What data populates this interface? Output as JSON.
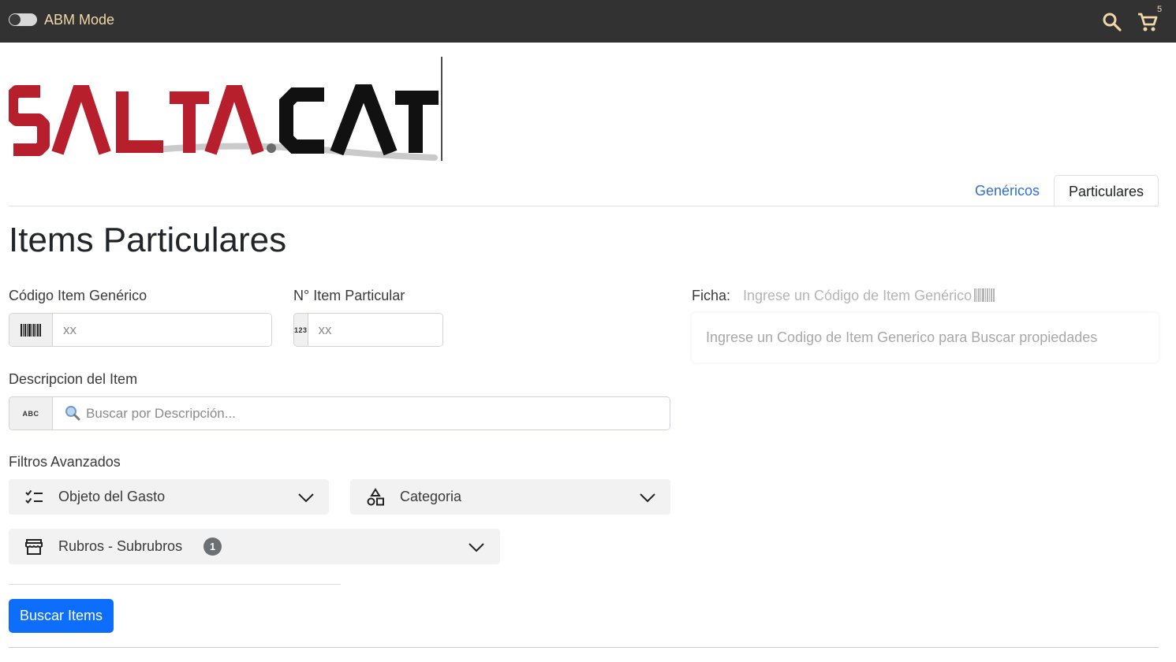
{
  "topbar": {
    "abm_mode_label": "ABM Mode",
    "abm_mode_on": false,
    "cart_count": "5"
  },
  "logo": {
    "text_part1": "SALTA",
    "text_dot": ".",
    "text_part2": "CAT",
    "color_primary": "#b61f2b",
    "color_secondary": "#111111"
  },
  "tabs": [
    {
      "label": "Genéricos",
      "active": false
    },
    {
      "label": "Particulares",
      "active": true
    }
  ],
  "page_title": "Items Particulares",
  "form": {
    "codigo_generico": {
      "label": "Código Item Genérico",
      "placeholder": "xx",
      "value": "",
      "icon": "barcode-icon"
    },
    "item_particular": {
      "label": "N° Item Particular",
      "placeholder": "xx",
      "value": "",
      "icon": "numeric-123-icon",
      "addon_text": "123"
    },
    "descripcion": {
      "label": "Descripcion del Item",
      "placeholder": "Buscar por Descripción...",
      "value": "",
      "icon": "abc-icon",
      "addon_text": "ABC"
    }
  },
  "ficha": {
    "label": "Ficha:",
    "hint": "Ingrese un Código de Item Genérico",
    "card_text": "Ingrese un Codigo de Item Generico para Buscar propiedades"
  },
  "filters": {
    "title": "Filtros Avanzados",
    "items": [
      {
        "label": "Objeto del Gasto",
        "icon": "checklist-icon"
      },
      {
        "label": "Categoria",
        "icon": "shapes-icon"
      },
      {
        "label": "Rubros - Subrubros",
        "icon": "store-icon",
        "badge": "1"
      }
    ]
  },
  "actions": {
    "search_label": "Buscar Items",
    "primary_color": "#0d6efd"
  }
}
